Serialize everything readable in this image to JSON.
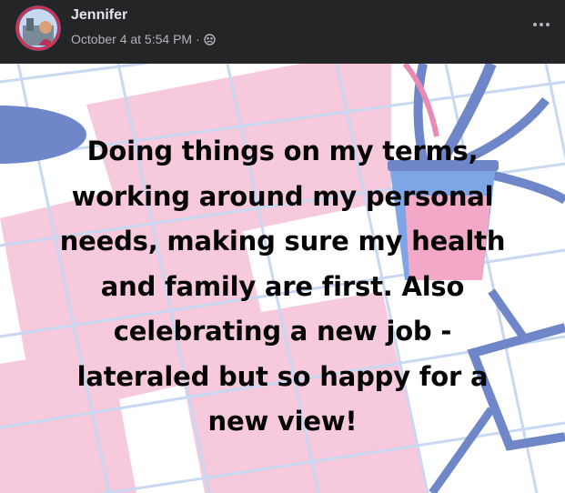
{
  "post": {
    "author": "Jennifer",
    "timestamp": "October 4 at 5:54 PM",
    "separator": "·",
    "audience_icon": "friends-icon",
    "more_icon": "more-horizontal-icon",
    "body_text": "Doing things on my terms,\nworking around my personal\nneeds, making sure my health\nand family are first. Also\ncelebrating a new job -\nlateraled but so happy for a\nnew view!"
  },
  "colors": {
    "header_bg": "#242526",
    "author_text": "#e4e6eb",
    "meta_text": "#b0b3b8",
    "background_pink": "#f6c9dc",
    "background_grid": "#c8d8f2",
    "plant_blue": "#6f86c9"
  }
}
